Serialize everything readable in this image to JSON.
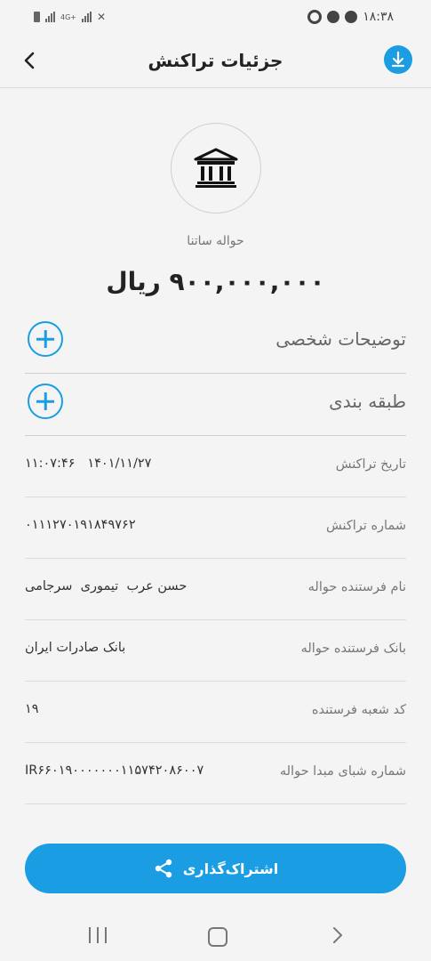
{
  "status_bar": {
    "time": "۱۸:۳۸",
    "network": "4G+"
  },
  "header": {
    "title": "جزئیات تراکنش"
  },
  "transaction": {
    "type": "حواله ساتنا",
    "amount": "۹۰۰,۰۰۰,۰۰۰ ریال"
  },
  "expanders": [
    {
      "label": "توضیحات شخصی"
    },
    {
      "label": "طبقه بندی"
    }
  ],
  "details": [
    {
      "label": "تاریخ تراکنش",
      "value": "۱۴۰۱/۱۱/۲۷   ۱۱:۰۷:۴۶"
    },
    {
      "label": "شماره تراکنش",
      "value": "۰۱۱۱۲۷۰۱۹۱۸۴۹۷۶۲"
    },
    {
      "label": "نام فرستنده حواله",
      "value": "حسن عرب  تیموری  سرجامی"
    },
    {
      "label": "بانک فرستنده حواله",
      "value": "بانک صادرات ایران"
    },
    {
      "label": "کد شعبه فرستنده",
      "value": "۱۹"
    },
    {
      "label": "شماره شبای مبدا حواله",
      "value": "IR۶۶۰۱۹۰۰۰۰۰۰۰۱۱۵۷۴۲۰۸۶۰۰۷"
    }
  ],
  "actions": {
    "share_label": "اشتراک‌گذاری"
  },
  "colors": {
    "accent": "#1a9de2",
    "background": "#f4f4f4"
  },
  "icons": {
    "back": "chevron-left-icon",
    "download": "download-icon",
    "bank": "bank-icon",
    "add": "plus-icon",
    "share": "share-icon"
  }
}
